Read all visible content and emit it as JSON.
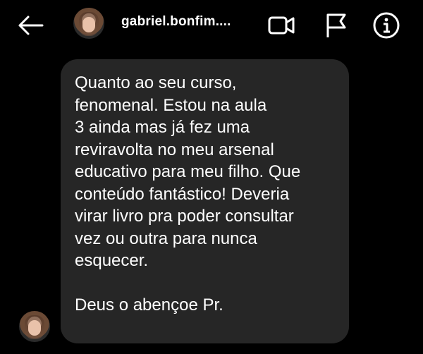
{
  "header": {
    "username": "gabriel.bonfim....",
    "icons": [
      "back-arrow-icon",
      "video-call-icon",
      "flag-icon",
      "info-icon"
    ]
  },
  "message": {
    "body": "Quanto ao seu curso,\nfenomenal. Estou na aula\n3 ainda mas já fez uma\nreviravolta no meu arsenal\neducativo para meu filho. Que\nconteúdo fantástico! Deveria\nvirar livro pra poder consultar\nvez ou outra para nunca\nesquecer.",
    "signoff": "Deus o abençoe Pr."
  },
  "colors": {
    "background": "#000000",
    "bubble": "#262626",
    "text": "#ffffff"
  }
}
